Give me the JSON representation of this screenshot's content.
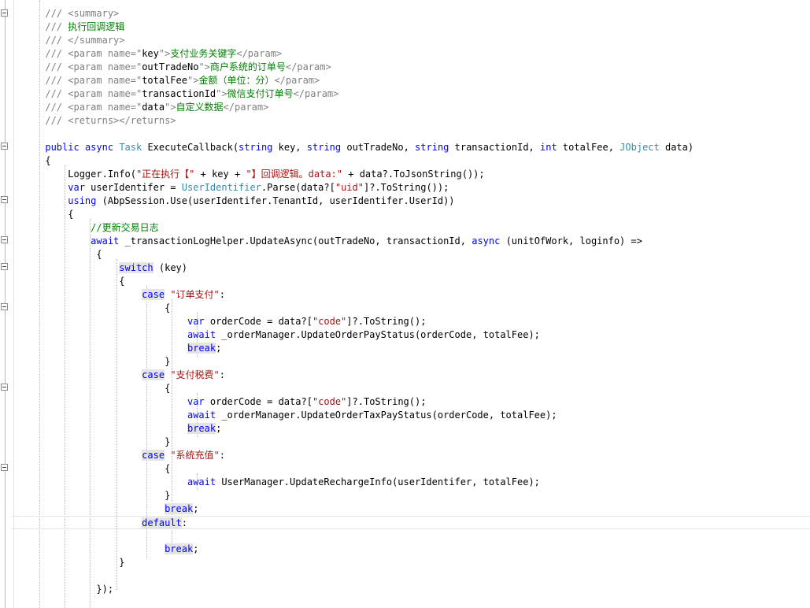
{
  "editor": {
    "lines": [
      {
        "indent": "      ",
        "tokens": [
          {
            "t": "/// <summary>",
            "c": "cmt"
          }
        ]
      },
      {
        "indent": "      ",
        "tokens": [
          {
            "t": "/// ",
            "c": "cmt"
          },
          {
            "t": "执行回调逻辑",
            "c": "cmt-text"
          }
        ]
      },
      {
        "indent": "      ",
        "tokens": [
          {
            "t": "/// </summary>",
            "c": "cmt"
          }
        ]
      },
      {
        "indent": "      ",
        "tokens": [
          {
            "t": "/// <param name=\"",
            "c": "cmt"
          },
          {
            "t": "key",
            "c": "plain"
          },
          {
            "t": "\">",
            "c": "cmt"
          },
          {
            "t": "支付业务关键字",
            "c": "cmt-text"
          },
          {
            "t": "</param>",
            "c": "cmt"
          }
        ]
      },
      {
        "indent": "      ",
        "tokens": [
          {
            "t": "/// <param name=\"",
            "c": "cmt"
          },
          {
            "t": "outTradeNo",
            "c": "plain"
          },
          {
            "t": "\">",
            "c": "cmt"
          },
          {
            "t": "商户系统的订单号",
            "c": "cmt-text"
          },
          {
            "t": "</param>",
            "c": "cmt"
          }
        ]
      },
      {
        "indent": "      ",
        "tokens": [
          {
            "t": "/// <param name=\"",
            "c": "cmt"
          },
          {
            "t": "totalFee",
            "c": "plain"
          },
          {
            "t": "\">",
            "c": "cmt"
          },
          {
            "t": "金额（单位：分）",
            "c": "cmt-text"
          },
          {
            "t": "</param>",
            "c": "cmt"
          }
        ]
      },
      {
        "indent": "      ",
        "tokens": [
          {
            "t": "/// <param name=\"",
            "c": "cmt"
          },
          {
            "t": "transactionId",
            "c": "plain"
          },
          {
            "t": "\">",
            "c": "cmt"
          },
          {
            "t": "微信支付订单号",
            "c": "cmt-text"
          },
          {
            "t": "</param>",
            "c": "cmt"
          }
        ]
      },
      {
        "indent": "      ",
        "tokens": [
          {
            "t": "/// <param name=\"",
            "c": "cmt"
          },
          {
            "t": "data",
            "c": "plain"
          },
          {
            "t": "\">",
            "c": "cmt"
          },
          {
            "t": "自定义数据",
            "c": "cmt-text"
          },
          {
            "t": "</param>",
            "c": "cmt"
          }
        ]
      },
      {
        "indent": "      ",
        "tokens": [
          {
            "t": "/// <returns></returns>",
            "c": "cmt"
          }
        ]
      },
      {
        "indent": "",
        "tokens": []
      },
      {
        "indent": "      ",
        "tokens": [
          {
            "t": "public",
            "c": "kw"
          },
          {
            "t": " ",
            "c": "plain"
          },
          {
            "t": "async",
            "c": "kw"
          },
          {
            "t": " ",
            "c": "plain"
          },
          {
            "t": "Task",
            "c": "type"
          },
          {
            "t": " ExecuteCallback(",
            "c": "plain"
          },
          {
            "t": "string",
            "c": "kw"
          },
          {
            "t": " key, ",
            "c": "plain"
          },
          {
            "t": "string",
            "c": "kw"
          },
          {
            "t": " outTradeNo, ",
            "c": "plain"
          },
          {
            "t": "string",
            "c": "kw"
          },
          {
            "t": " transactionId, ",
            "c": "plain"
          },
          {
            "t": "int",
            "c": "kw"
          },
          {
            "t": " totalFee, ",
            "c": "plain"
          },
          {
            "t": "JObject",
            "c": "type"
          },
          {
            "t": " data)",
            "c": "plain"
          }
        ]
      },
      {
        "indent": "      ",
        "tokens": [
          {
            "t": "{",
            "c": "plain"
          }
        ]
      },
      {
        "indent": "          ",
        "tokens": [
          {
            "t": "Logger.Info(",
            "c": "plain"
          },
          {
            "t": "\"正在执行【\"",
            "c": "str"
          },
          {
            "t": " + key + ",
            "c": "plain"
          },
          {
            "t": "\"】回调逻辑。data:\"",
            "c": "str"
          },
          {
            "t": " + data?.ToJsonString());",
            "c": "plain"
          }
        ]
      },
      {
        "indent": "          ",
        "tokens": [
          {
            "t": "var",
            "c": "kw"
          },
          {
            "t": " userIdentifer = ",
            "c": "plain"
          },
          {
            "t": "UserIdentifier",
            "c": "type"
          },
          {
            "t": ".Parse(data?[",
            "c": "plain"
          },
          {
            "t": "\"uid\"",
            "c": "str"
          },
          {
            "t": "]?.ToString());",
            "c": "plain"
          }
        ]
      },
      {
        "indent": "          ",
        "tokens": [
          {
            "t": "using",
            "c": "kw"
          },
          {
            "t": " (AbpSession.Use(userIdentifer.TenantId, userIdentifer.UserId))",
            "c": "plain"
          }
        ]
      },
      {
        "indent": "          ",
        "tokens": [
          {
            "t": "{",
            "c": "plain"
          }
        ]
      },
      {
        "indent": "              ",
        "tokens": [
          {
            "t": "//更新交易日志",
            "c": "cmt-text"
          }
        ]
      },
      {
        "indent": "              ",
        "tokens": [
          {
            "t": "await",
            "c": "kw"
          },
          {
            "t": " _transactionLogHelper.UpdateAsync(outTradeNo, transactionId, ",
            "c": "plain"
          },
          {
            "t": "async",
            "c": "kw"
          },
          {
            "t": " (unitOfWork, loginfo) =>",
            "c": "plain"
          }
        ]
      },
      {
        "indent": "               ",
        "tokens": [
          {
            "t": "{",
            "c": "plain"
          }
        ]
      },
      {
        "indent": "                   ",
        "tokens": [
          {
            "t": "switch",
            "c": "kw-hl"
          },
          {
            "t": " (key)",
            "c": "plain"
          }
        ]
      },
      {
        "indent": "                   ",
        "tokens": [
          {
            "t": "{",
            "c": "plain"
          }
        ]
      },
      {
        "indent": "                       ",
        "tokens": [
          {
            "t": "case",
            "c": "kw-hl"
          },
          {
            "t": " ",
            "c": "plain"
          },
          {
            "t": "\"订单支付\"",
            "c": "str"
          },
          {
            "t": ":",
            "c": "plain"
          }
        ]
      },
      {
        "indent": "                           ",
        "tokens": [
          {
            "t": "{",
            "c": "plain"
          }
        ]
      },
      {
        "indent": "                               ",
        "tokens": [
          {
            "t": "var",
            "c": "kw"
          },
          {
            "t": " orderCode = data?[",
            "c": "plain"
          },
          {
            "t": "\"code\"",
            "c": "str"
          },
          {
            "t": "]?.ToString();",
            "c": "plain"
          }
        ]
      },
      {
        "indent": "                               ",
        "tokens": [
          {
            "t": "await",
            "c": "kw"
          },
          {
            "t": " _orderManager.UpdateOrderPayStatus(orderCode, totalFee);",
            "c": "plain"
          }
        ]
      },
      {
        "indent": "                               ",
        "tokens": [
          {
            "t": "break",
            "c": "kw-hl"
          },
          {
            "t": ";",
            "c": "plain"
          }
        ]
      },
      {
        "indent": "                           ",
        "tokens": [
          {
            "t": "}",
            "c": "plain"
          }
        ]
      },
      {
        "indent": "                       ",
        "tokens": [
          {
            "t": "case",
            "c": "kw-hl"
          },
          {
            "t": " ",
            "c": "plain"
          },
          {
            "t": "\"支付税费\"",
            "c": "str"
          },
          {
            "t": ":",
            "c": "plain"
          }
        ]
      },
      {
        "indent": "                           ",
        "tokens": [
          {
            "t": "{",
            "c": "plain"
          }
        ]
      },
      {
        "indent": "                               ",
        "tokens": [
          {
            "t": "var",
            "c": "kw"
          },
          {
            "t": " orderCode = data?[",
            "c": "plain"
          },
          {
            "t": "\"code\"",
            "c": "str"
          },
          {
            "t": "]?.ToString();",
            "c": "plain"
          }
        ]
      },
      {
        "indent": "                               ",
        "tokens": [
          {
            "t": "await",
            "c": "kw"
          },
          {
            "t": " _orderManager.UpdateOrderTaxPayStatus(orderCode, totalFee);",
            "c": "plain"
          }
        ]
      },
      {
        "indent": "                               ",
        "tokens": [
          {
            "t": "break",
            "c": "kw-hl"
          },
          {
            "t": ";",
            "c": "plain"
          }
        ]
      },
      {
        "indent": "                           ",
        "tokens": [
          {
            "t": "}",
            "c": "plain"
          }
        ]
      },
      {
        "indent": "                       ",
        "tokens": [
          {
            "t": "case",
            "c": "kw-hl"
          },
          {
            "t": " ",
            "c": "plain"
          },
          {
            "t": "\"系统充值\"",
            "c": "str"
          },
          {
            "t": ":",
            "c": "plain"
          }
        ]
      },
      {
        "indent": "                           ",
        "tokens": [
          {
            "t": "{",
            "c": "plain"
          }
        ]
      },
      {
        "indent": "                               ",
        "tokens": [
          {
            "t": "await",
            "c": "kw"
          },
          {
            "t": " UserManager.UpdateRechargeInfo(userIdentifer, totalFee);",
            "c": "plain"
          }
        ]
      },
      {
        "indent": "                           ",
        "tokens": [
          {
            "t": "}",
            "c": "plain"
          }
        ]
      },
      {
        "indent": "                           ",
        "tokens": [
          {
            "t": "break",
            "c": "kw-hl"
          },
          {
            "t": ";",
            "c": "plain"
          }
        ]
      },
      {
        "indent": "                       ",
        "tokens": [
          {
            "t": "default",
            "c": "kw-hl"
          },
          {
            "t": ":",
            "c": "plain"
          }
        ]
      },
      {
        "indent": "",
        "tokens": []
      },
      {
        "indent": "                           ",
        "tokens": [
          {
            "t": "break",
            "c": "kw-hl"
          },
          {
            "t": ";",
            "c": "plain"
          }
        ]
      },
      {
        "indent": "                   ",
        "tokens": [
          {
            "t": "}",
            "c": "plain"
          }
        ]
      },
      {
        "indent": "",
        "tokens": []
      },
      {
        "indent": "               ",
        "tokens": [
          {
            "t": "});",
            "c": "plain"
          }
        ]
      }
    ]
  },
  "colors": {
    "keyword": "#0000ff",
    "comment": "#808080",
    "comment_text": "#008000",
    "string": "#a31515",
    "type": "#2b91af"
  }
}
